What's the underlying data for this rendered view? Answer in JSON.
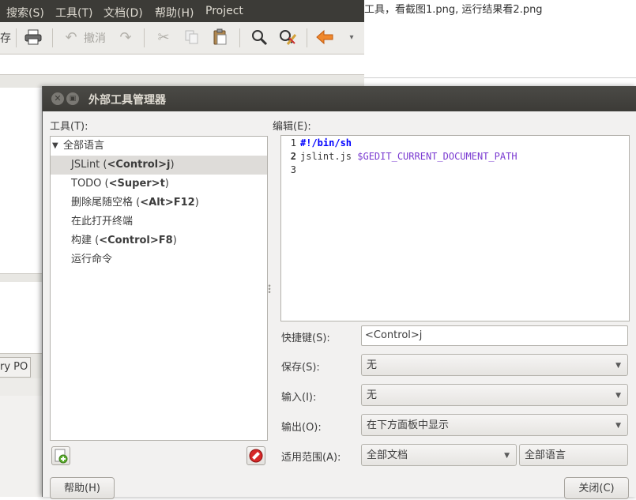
{
  "background_window": {
    "menu": [
      "搜索(S)",
      "工具(T)",
      "文档(D)",
      "帮助(H)",
      "Project"
    ],
    "toolbar": {
      "print_icon": "printer-icon",
      "undo_label": "撤消",
      "save_label_partial": "存"
    },
    "document_text": "工具，看截图1.png, 运行结果看2.png",
    "bottom_tab_label": "ry PO"
  },
  "dialog": {
    "title": "外部工具管理器",
    "tools_label": "工具(T):",
    "edit_label": "编辑(E):",
    "tree": {
      "group": "全部语言",
      "items": [
        {
          "name": "JSLint",
          "shortcut": "<Control>j",
          "selected": true
        },
        {
          "name": "TODO",
          "shortcut": "<Super>t",
          "selected": false
        },
        {
          "name": "删除尾随空格",
          "shortcut": "<Alt>F12",
          "selected": false
        },
        {
          "name": "在此打开终端",
          "shortcut": "",
          "selected": false
        },
        {
          "name": "构建",
          "shortcut": "<Control>F8",
          "selected": false
        },
        {
          "name": "运行命令",
          "shortcut": "",
          "selected": false
        }
      ]
    },
    "editor": {
      "line_numbers": [
        "1",
        "2",
        "3"
      ],
      "line1": "#!/bin/sh",
      "line2_cmd": "jslint.js ",
      "line2_var": "$GEDIT_CURRENT_DOCUMENT_PATH"
    },
    "shortcut": {
      "label": "快捷键(S):",
      "value": "<Control>j"
    },
    "save": {
      "label": "保存(S):",
      "value": "无"
    },
    "input": {
      "label": "输入(I):",
      "value": "无"
    },
    "output": {
      "label": "输出(O):",
      "value": "在下方面板中显示"
    },
    "applicability": {
      "label": "适用范围(A):",
      "scope": "全部文档",
      "language": "全部语言"
    },
    "help_button": "帮助(H)",
    "close_button": "关闭(C)"
  }
}
